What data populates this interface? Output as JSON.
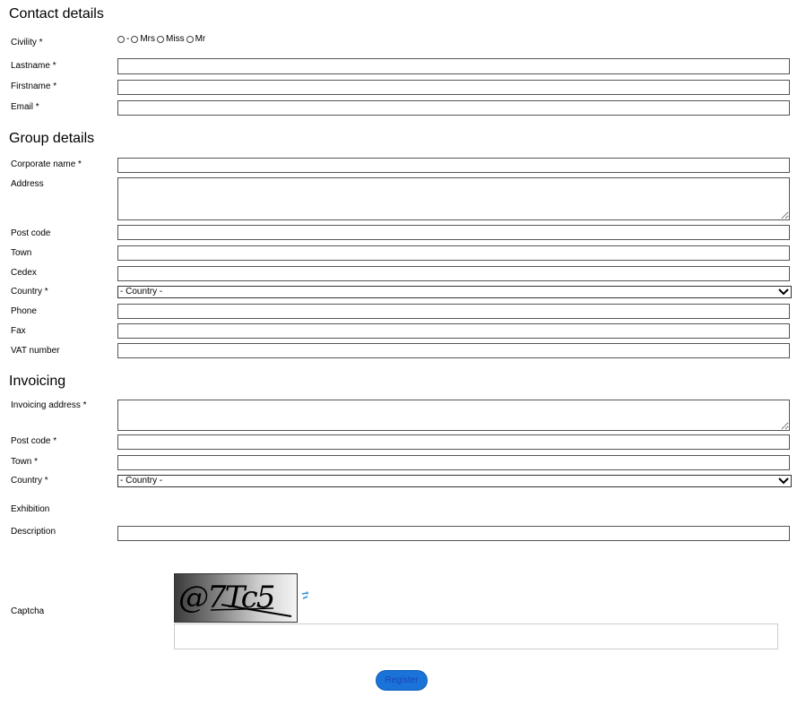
{
  "contact": {
    "title": "Contact details",
    "civility_label": "Civility *",
    "civility_options": [
      "-",
      "Mrs",
      "Miss",
      "Mr"
    ],
    "lastname_label": "Lastname *",
    "firstname_label": "Firstname *",
    "email_label": "Email *"
  },
  "group": {
    "title": "Group details",
    "corporate_label": "Corporate name *",
    "address_label": "Address",
    "postcode_label": "Post code",
    "town_label": "Town",
    "cedex_label": "Cedex",
    "country_label": "Country *",
    "country_value": "- Country -",
    "phone_label": "Phone",
    "fax_label": "Fax",
    "vat_label": "VAT number"
  },
  "invoicing": {
    "title": "Invoicing",
    "address_label": "Invoicing address *",
    "postcode_label": "Post code *",
    "town_label": "Town *",
    "country_label": "Country *",
    "country_value": "- Country -",
    "exhibition_label": "Exhibition",
    "description_label": "Description"
  },
  "captcha": {
    "label": "Captcha",
    "image_text": "@7Tc5"
  },
  "register_label": "Register",
  "colors": {
    "button_bg": "#1a73d9",
    "button_text": "#1c44b8",
    "refresh_icon": "#2a8fd8"
  }
}
